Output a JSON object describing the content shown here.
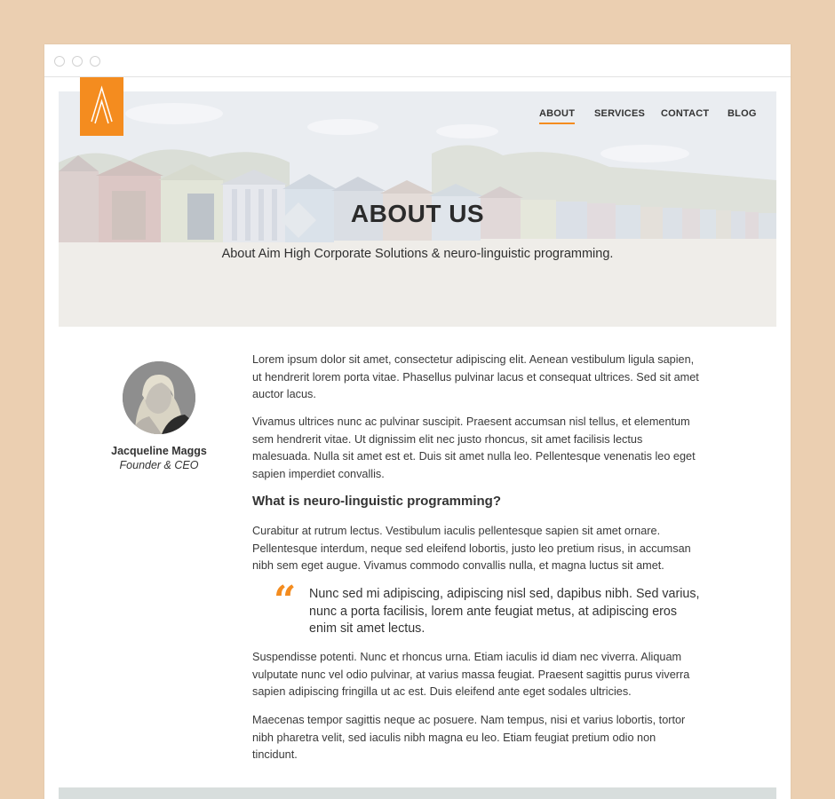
{
  "nav": {
    "items": [
      {
        "label": "ABOUT",
        "active": true
      },
      {
        "label": "SERVICES",
        "active": false
      },
      {
        "label": "CONTACT",
        "active": false
      },
      {
        "label": "BLOG",
        "active": false
      }
    ]
  },
  "hero": {
    "title": "ABOUT US",
    "subtitle": "About Aim High Corporate Solutions & neuro-linguistic programming."
  },
  "profile": {
    "name": "Jacqueline Maggs",
    "role": "Founder & CEO"
  },
  "content": {
    "p1": "Lorem ipsum dolor sit amet, consectetur adipiscing elit. Aenean vestibulum ligula sapien, ut hendrerit lorem porta vitae. Phasellus pulvinar lacus et consequat ultrices. Sed sit amet auctor lacus.",
    "p2": "Vivamus ultrices nunc ac pulvinar suscipit. Praesent accumsan nisl tellus, et elementum sem hendrerit vitae. Ut dignissim elit nec justo rhoncus, sit amet facilisis lectus malesuada. Nulla sit amet est et. Duis sit amet nulla leo. Pellentesque venenatis leo eget sapien imperdiet convallis.",
    "heading": "What is neuro-linguistic programming?",
    "p3": "Curabitur at rutrum lectus. Vestibulum iaculis pellentesque sapien sit amet ornare. Pellentesque interdum, neque sed eleifend lobortis, justo leo pretium risus, in accumsan nibh sem eget augue. Vivamus commodo convallis nulla, et magna luctus sit amet.",
    "quote_mark": "“",
    "quote": "Nunc sed mi adipiscing, adipiscing nisl sed, dapibus nibh. Sed varius, nunc a porta facilisis, lorem ante feugiat metus, at adipiscing eros enim sit amet lectus.",
    "p4": "Suspendisse potenti. Nunc et rhoncus urna. Etiam iaculis id diam nec viverra. Aliquam vulputate nunc vel odio pulvinar, at varius massa feugiat. Praesent sagittis purus viverra sapien adipiscing fringilla ut ac est. Duis eleifend ante eget sodales ultricies.",
    "p5": "Maecenas tempor sagittis neque ac posuere. Nam tempus, nisi et varius lobortis, tortor nibh pharetra velit, sed iaculis nibh magna eu leo. Etiam feugiat pretium odio non tincidunt."
  },
  "colors": {
    "accent": "#f48c1f",
    "page_background": "#ebcfb1",
    "footer_band": "#d8dedd"
  },
  "icons": {
    "logo": "aim-high-chevron-logo",
    "quote": "quote-icon"
  }
}
